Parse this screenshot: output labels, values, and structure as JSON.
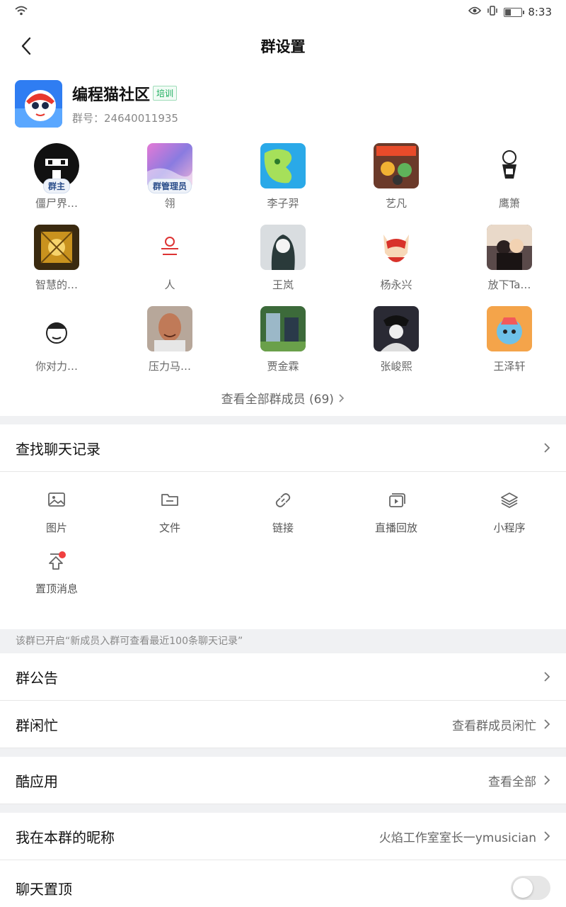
{
  "status": {
    "time": "8:33",
    "battery_level": 0.35
  },
  "nav": {
    "title": "群设置"
  },
  "group": {
    "name": "编程猫社区",
    "tag": "培训",
    "id_line": "群号：24640011935"
  },
  "members": [
    {
      "name": "僵尸界…",
      "role": "群主"
    },
    {
      "name": "翎",
      "role": "群管理员"
    },
    {
      "name": "李子羿",
      "role": ""
    },
    {
      "name": "艺凡",
      "role": ""
    },
    {
      "name": "鹰箫",
      "role": ""
    },
    {
      "name": "智慧的…",
      "role": ""
    },
    {
      "name": "人",
      "role": ""
    },
    {
      "name": "王岚",
      "role": ""
    },
    {
      "name": "杨永兴",
      "role": ""
    },
    {
      "name": "放下Ta…",
      "role": ""
    },
    {
      "name": "你对力…",
      "role": ""
    },
    {
      "name": "压力马…",
      "role": ""
    },
    {
      "name": "贾金霖",
      "role": ""
    },
    {
      "name": "张峻熙",
      "role": ""
    },
    {
      "name": "王泽轩",
      "role": ""
    }
  ],
  "view_all_label": "查看全部群成员 (69)",
  "search_history_label": "查找聊天记录",
  "tools": [
    {
      "label": "图片",
      "icon": "image-icon"
    },
    {
      "label": "文件",
      "icon": "folder-icon"
    },
    {
      "label": "链接",
      "icon": "link-icon"
    },
    {
      "label": "直播回放",
      "icon": "live-replay-icon"
    },
    {
      "label": "小程序",
      "icon": "layers-icon"
    },
    {
      "label": "置顶消息",
      "icon": "pin-top-icon"
    }
  ],
  "notice_text": "该群已开启“新成员入群可查看最近100条聊天记录”",
  "settings": {
    "announcement": {
      "label": "群公告"
    },
    "busy": {
      "label": "群闲忙",
      "value": "查看群成员闲忙"
    },
    "apps": {
      "label": "酷应用",
      "value": "查看全部"
    },
    "nickname": {
      "label": "我在本群的昵称",
      "value": "火焰工作室室长一ymusician"
    },
    "pin_chat": {
      "label": "聊天置顶",
      "enabled": false
    }
  }
}
